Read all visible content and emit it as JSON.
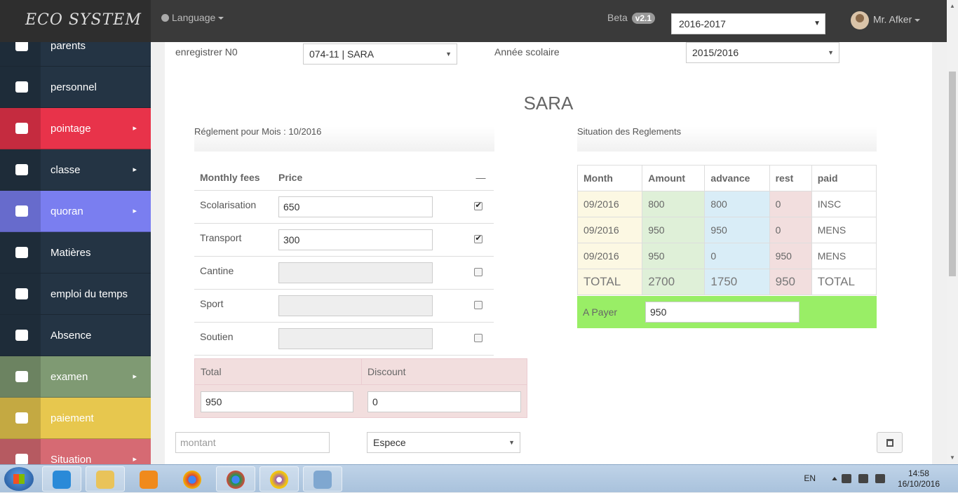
{
  "topbar": {
    "brand": "ECO SYSTEM",
    "language": "Language",
    "beta_label": "Beta",
    "version": "v2.1",
    "year": "2016-2017",
    "user": "Mr. Afker"
  },
  "sidebar": {
    "items": [
      {
        "label": "parents",
        "icon": "user-icon",
        "color": "#243444",
        "arrow": ""
      },
      {
        "label": "personnel",
        "icon": "users-icon",
        "color": "#243444",
        "arrow": ""
      },
      {
        "label": "pointage",
        "icon": "clock-icon",
        "color": "#e8334a",
        "arrow": "▸"
      },
      {
        "label": "classe",
        "icon": "briefcase-icon",
        "color": "#243444",
        "arrow": "▸"
      },
      {
        "label": "quoran",
        "icon": "trophy-icon",
        "color": "#7a7ef0",
        "arrow": "▸"
      },
      {
        "label": "Matières",
        "icon": "book-icon",
        "color": "#243444",
        "arrow": ""
      },
      {
        "label": "emploi du temps",
        "icon": "clock-icon",
        "color": "#243444",
        "arrow": ""
      },
      {
        "label": "Absence",
        "icon": "rss-icon",
        "color": "#243444",
        "arrow": ""
      },
      {
        "label": "examen",
        "icon": "bar-chart-icon",
        "color": "#7f9a73",
        "arrow": "▸"
      },
      {
        "label": "paiement",
        "icon": "credit-card-icon",
        "color": "#e7c74e",
        "arrow": ""
      },
      {
        "label": "Situation",
        "icon": "list-icon",
        "color": "#d66a73",
        "arrow": "▸"
      }
    ]
  },
  "form": {
    "record_label": "enregistrer N0",
    "record_value": "074-11 | SARA",
    "year_label": "Année scolaire",
    "year_value": "2015/2016",
    "student_name": "SARA"
  },
  "fees_panel": {
    "heading": "Réglement pour Mois : 10/2016",
    "col_fees": "Monthly fees",
    "col_price": "Price",
    "col_check": "—",
    "rows": [
      {
        "name": "Scolarisation",
        "price": "650",
        "checked": true
      },
      {
        "name": "Transport",
        "price": "300",
        "checked": true
      },
      {
        "name": "Cantine",
        "price": "",
        "checked": false
      },
      {
        "name": "Sport",
        "price": "",
        "checked": false
      },
      {
        "name": "Soutien",
        "price": "",
        "checked": false
      }
    ],
    "total_label": "Total",
    "discount_label": "Discount",
    "total_value": "950",
    "discount_value": "0"
  },
  "situation": {
    "heading": "Situation des Reglements",
    "headers": [
      "Month",
      "Amount",
      "advance",
      "rest",
      "paid"
    ],
    "rows": [
      [
        "09/2016",
        "800",
        "800",
        "0",
        "INSC"
      ],
      [
        "09/2016",
        "950",
        "950",
        "0",
        "MENS"
      ],
      [
        "09/2016",
        "950",
        "0",
        "950",
        "MENS"
      ]
    ],
    "total_row": [
      "TOTAL",
      "2700",
      "1750",
      "950",
      "TOTAL"
    ],
    "a_payer_label": "A Payer",
    "a_payer_value": "950"
  },
  "payment": {
    "amount_placeholder": "montant",
    "method": "Espece"
  },
  "taskbar": {
    "lang": "EN",
    "time": "14:58",
    "date": "16/10/2016"
  }
}
